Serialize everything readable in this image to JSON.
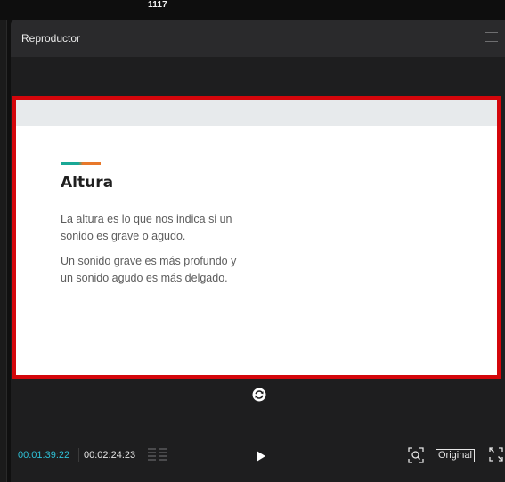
{
  "top": {
    "number": "1117"
  },
  "panel": {
    "title": "Reproductor"
  },
  "slide": {
    "heading": "Altura",
    "paragraphs": [
      "La altura es lo que nos indica si un sonido es grave o agudo.",
      "Un sonido grave es más profundo y un sonido agudo es más delgado."
    ]
  },
  "controls": {
    "time_current": "00:01:39:22",
    "time_total": "00:02:24:23",
    "original_label": "Original"
  },
  "colors": {
    "accent_teal": "#1aa896",
    "accent_orange": "#e8782a",
    "time_current": "#2fc0d6",
    "stage_border": "#d4060b"
  },
  "icons": [
    "menu-icon",
    "replay-icon",
    "chapters-icon",
    "play-icon",
    "focus-icon",
    "fullscreen-icon"
  ]
}
